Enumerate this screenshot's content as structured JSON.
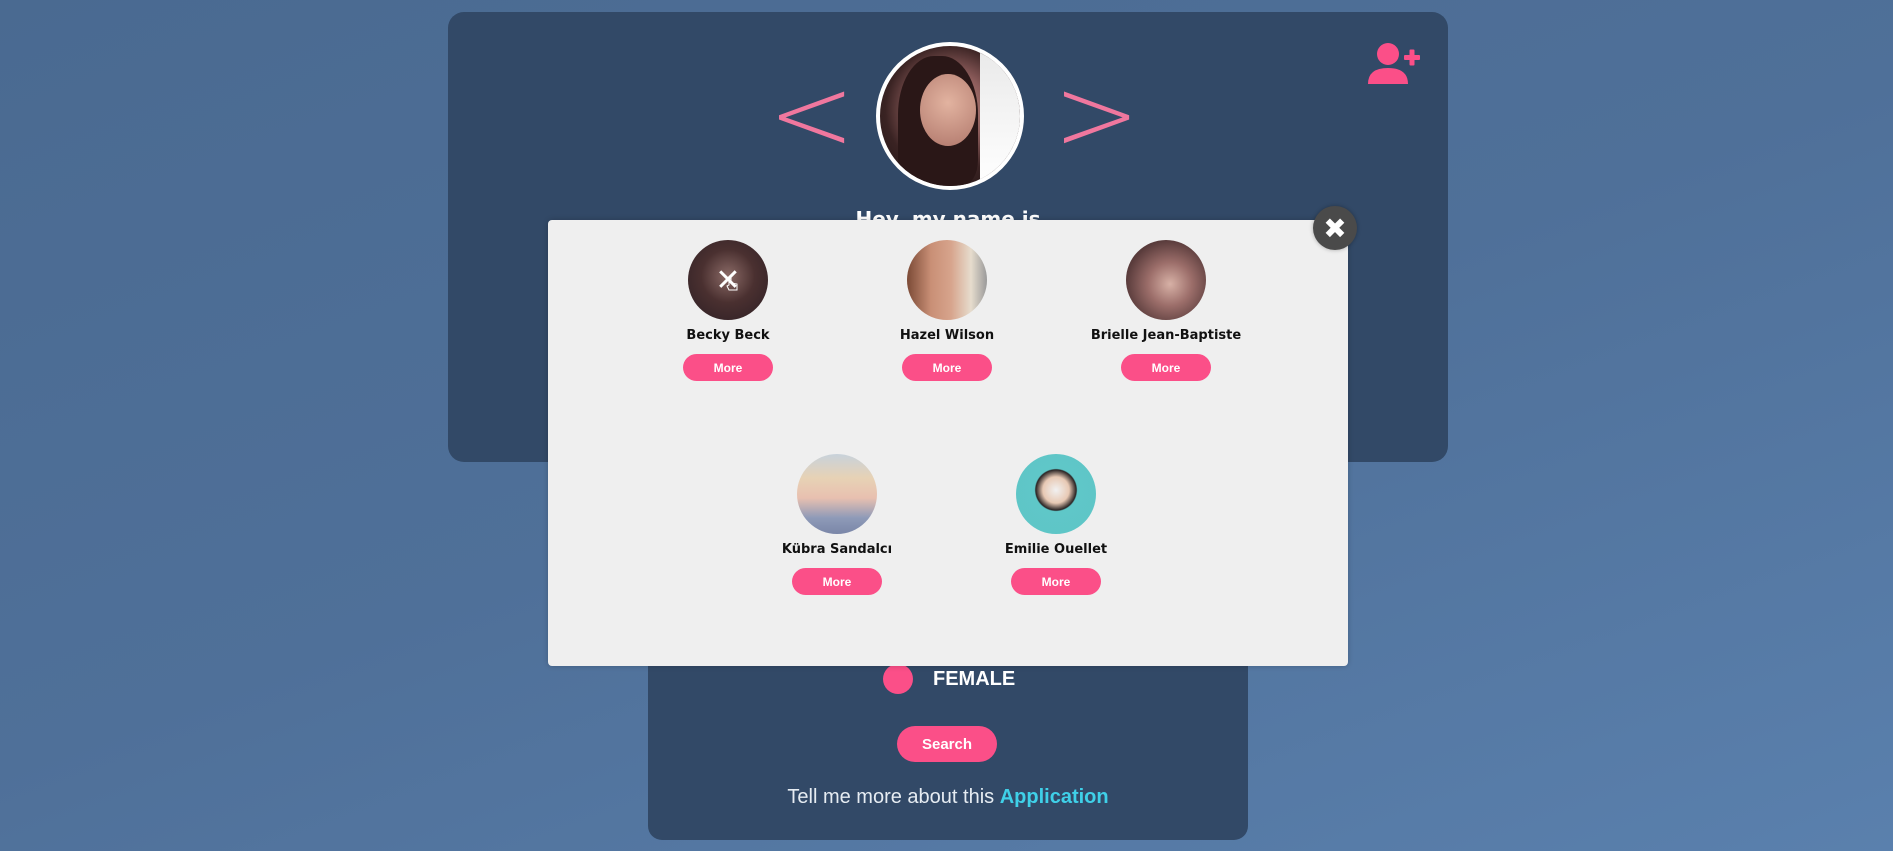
{
  "profile_card": {
    "prev_arrow": "<",
    "next_arrow": ">",
    "greeting": "Hey, my name is"
  },
  "icons": {
    "add_user": "user-plus-icon",
    "close": "close-icon"
  },
  "colors": {
    "accent": "#fb4f88",
    "card": "#324967",
    "link": "#3fd0e8",
    "modal": "#efefef"
  },
  "modal": {
    "close_label": "✖",
    "profiles": [
      {
        "name": "Becky Beck",
        "button": "More"
      },
      {
        "name": "Hazel Wilson",
        "button": "More"
      },
      {
        "name": "Brielle Jean-Baptiste",
        "button": "More"
      },
      {
        "name": "Kübra Sandalcı",
        "button": "More"
      },
      {
        "name": "Emilie Ouellet",
        "button": "More"
      }
    ]
  },
  "filter": {
    "gender_label": "FEMALE",
    "search_label": "Search"
  },
  "footer": {
    "text": "Tell me more about this ",
    "link": "Application"
  }
}
